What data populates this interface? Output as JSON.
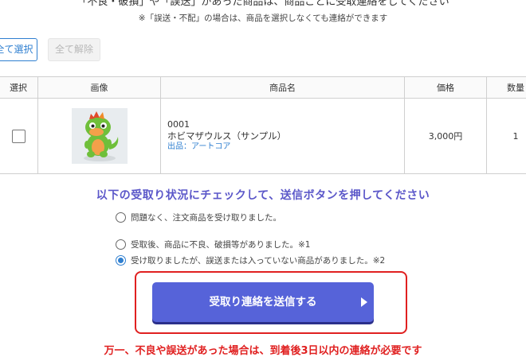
{
  "top_line": "「不良・破損」や「誤送」があった商品は、商品ごとに受取連絡をしてください",
  "note": "※「誤送・不配」の場合は、商品を選択しなくても連絡ができます",
  "buttons": {
    "select_all": "全て選択",
    "clear_all": "全て解除"
  },
  "table": {
    "headers": {
      "select": "選択",
      "image": "画像",
      "name": "商品名",
      "price": "価格",
      "qty": "数量"
    },
    "rows": [
      {
        "code": "0001",
        "name": "ホビマザウルス（サンプル）",
        "seller": "出品：アートコア",
        "price": "3,000円",
        "qty": "1",
        "checked": false,
        "image_icon": "dinosaur-toy-image"
      }
    ]
  },
  "heading": "以下の受取り状況にチェックして、送信ボタンを押してください",
  "options": [
    {
      "label": "問題なく、注文商品を受け取りました。",
      "selected": false
    },
    {
      "label": "受取後、商品に不良、破損等がありました。※1",
      "selected": false
    },
    {
      "label": "受け取りましたが、誤送または入っていない商品がありました。※2",
      "selected": true
    }
  ],
  "submit_label": "受取り連絡を送信する",
  "bottom_line": "万一、不良や誤送があった場合は、到着後3日以内の連絡が必要です",
  "colors": {
    "accent": "#5663d9",
    "link": "#2f7fd0",
    "highlight": "#e02020",
    "heading": "#5b57c9"
  }
}
